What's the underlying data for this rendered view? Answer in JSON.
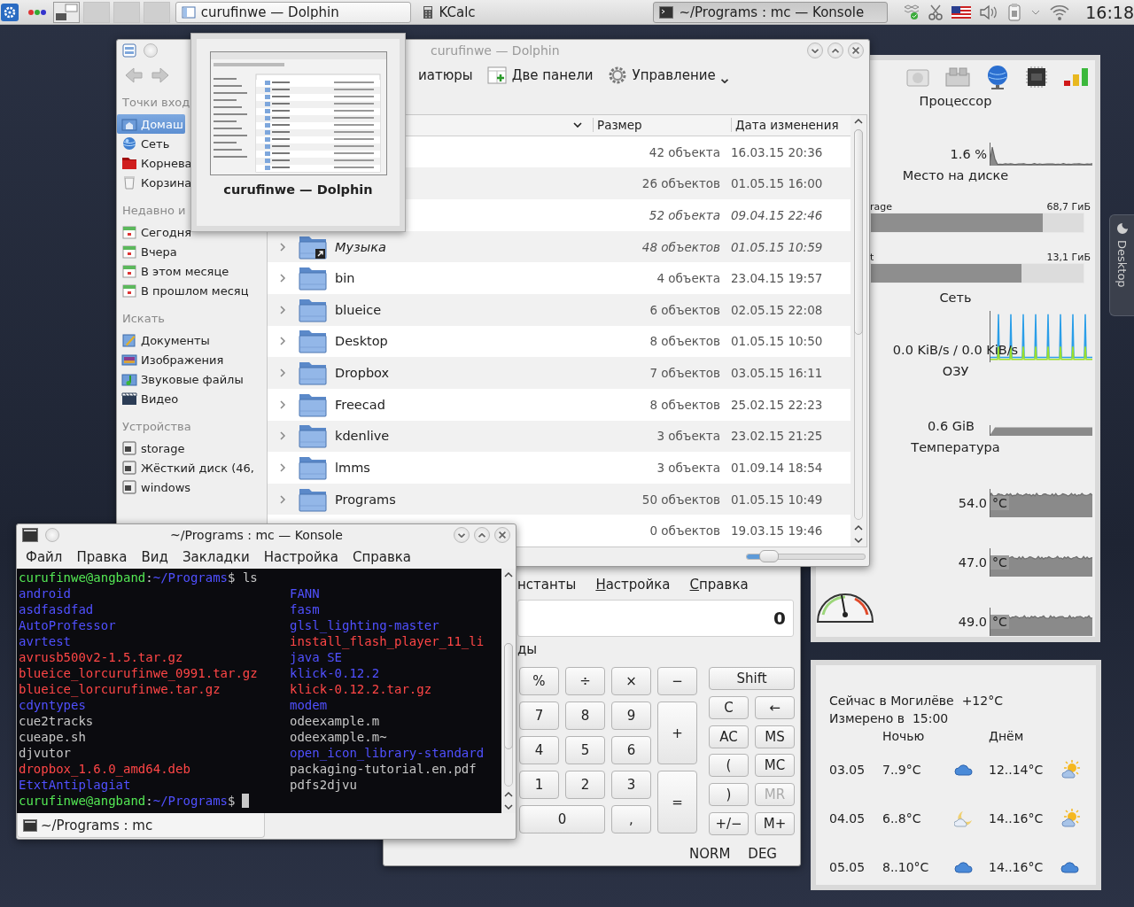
{
  "taskbar": {
    "pager": [
      {
        "selected": true
      },
      {
        "selected": false
      },
      {
        "selected": false
      },
      {
        "selected": false
      }
    ],
    "tasks": [
      {
        "title": "curufinwe — Dolphin",
        "kind": "framed",
        "selected": false
      },
      {
        "title": "KCalc",
        "kind": "plain",
        "selected": false
      },
      {
        "title": "~/Programs : mc — Konsole",
        "kind": "framed",
        "selected": true
      }
    ],
    "clock": "16:18"
  },
  "dolphin": {
    "title": "curufinwe — Dolphin",
    "toolbar": [
      {
        "label": "иатюры",
        "kind": "plain"
      },
      {
        "label": "Две панели",
        "kind": "split"
      },
      {
        "label": "Управление",
        "kind": "menu"
      }
    ],
    "places": [
      {
        "title": "Точки вход",
        "items": [
          {
            "label": "Домаш",
            "kind": "home",
            "selected": true
          },
          {
            "label": "Сеть",
            "kind": "network",
            "selected": false
          },
          {
            "label": "Корнева",
            "kind": "root",
            "selected": false
          },
          {
            "label": "Корзина",
            "kind": "trash",
            "selected": false
          }
        ]
      },
      {
        "title": "Недавно и",
        "items": [
          {
            "label": "Сегодня",
            "kind": "calendar",
            "selected": false
          },
          {
            "label": "Вчера",
            "kind": "calendar",
            "selected": false
          },
          {
            "label": "В этом месяце",
            "kind": "calendar",
            "selected": false
          },
          {
            "label": "В прошлом месяц",
            "kind": "calendar",
            "selected": false
          }
        ]
      },
      {
        "title": "Искать",
        "items": [
          {
            "label": "Документы",
            "kind": "docs",
            "selected": false
          },
          {
            "label": "Изображения",
            "kind": "images",
            "selected": false
          },
          {
            "label": "Звуковые файлы",
            "kind": "audio",
            "selected": false
          },
          {
            "label": "Видео",
            "kind": "video",
            "selected": false
          }
        ]
      },
      {
        "title": "Устройства",
        "items": [
          {
            "label": "storage",
            "kind": "drive",
            "selected": false
          },
          {
            "label": "Жёсткий диск (46,",
            "kind": "drive",
            "selected": false
          },
          {
            "label": "windows",
            "kind": "drive",
            "selected": false
          }
        ]
      }
    ],
    "columns": [
      "Размер",
      "Дата изменения"
    ],
    "rows": [
      {
        "size": "42 объекта",
        "date": "16.03.15 20:36",
        "symlink": false
      },
      {
        "size": "26 объектов",
        "date": "01.05.15 16:00",
        "symlink": false
      },
      {
        "size": "52 объекта",
        "date": "09.04.15 22:46",
        "symlink": true
      },
      {
        "name": "Музыка",
        "size": "48 объектов",
        "date": "01.05.15 10:59",
        "symlink": true
      },
      {
        "name": "bin",
        "size": "4 объекта",
        "date": "23.04.15 19:57",
        "symlink": false
      },
      {
        "name": "blueice",
        "size": "6 объектов",
        "date": "02.05.15 22:08",
        "symlink": false
      },
      {
        "name": "Desktop",
        "size": "8 объектов",
        "date": "01.05.15 10:50",
        "symlink": false
      },
      {
        "name": "Dropbox",
        "size": "7 объектов",
        "date": "03.05.15 16:11",
        "symlink": false
      },
      {
        "name": "Freecad",
        "size": "8 объектов",
        "date": "25.02.15 22:23",
        "symlink": false
      },
      {
        "name": "kdenlive",
        "size": "3 объекта",
        "date": "23.02.15 21:25",
        "symlink": false
      },
      {
        "name": "lmms",
        "size": "3 объекта",
        "date": "01.09.14 18:54",
        "symlink": false
      },
      {
        "name": "Programs",
        "size": "50 объектов",
        "date": "01.05.15 10:49",
        "symlink": false
      },
      {
        "size": "0 объектов",
        "date": "19.03.15 19:46",
        "symlink": false
      }
    ],
    "zoom": {
      "level": 0.15
    }
  },
  "preview": {
    "caption": "curufinwe — Dolphin"
  },
  "kcalc": {
    "menu": [
      {
        "label": "нстанты",
        "mnemonic": false
      },
      {
        "label": "Настройка",
        "mnemonic": true
      },
      {
        "label": "Справка",
        "mnemonic": true
      }
    ],
    "display": "0",
    "radio_label": "ды",
    "keypad": [
      {
        "label": "%",
        "wide": false,
        "tall": false
      },
      {
        "label": "÷",
        "wide": false,
        "tall": false
      },
      {
        "label": "×",
        "wide": false,
        "tall": false
      },
      {
        "label": "−",
        "wide": false,
        "tall": false
      },
      {
        "label": "7",
        "wide": false,
        "tall": false
      },
      {
        "label": "8",
        "wide": false,
        "tall": false
      },
      {
        "label": "9",
        "wide": false,
        "tall": false
      },
      {
        "label": "+",
        "wide": false,
        "tall": true
      },
      {
        "label": "4",
        "wide": false,
        "tall": false
      },
      {
        "label": "5",
        "wide": false,
        "tall": false
      },
      {
        "label": "6",
        "wide": false,
        "tall": false
      },
      {
        "label": "1",
        "wide": false,
        "tall": false
      },
      {
        "label": "2",
        "wide": false,
        "tall": false
      },
      {
        "label": "3",
        "wide": false,
        "tall": false
      },
      {
        "label": "=",
        "wide": false,
        "tall": true
      },
      {
        "label": "0",
        "wide": true,
        "tall": false
      },
      {
        "label": ",",
        "wide": false,
        "tall": false
      }
    ],
    "memory": [
      {
        "label": "Shift",
        "wide": true,
        "disabled": false
      },
      {
        "label": "C",
        "wide": false,
        "disabled": false
      },
      {
        "label": "←",
        "wide": false,
        "disabled": false
      },
      {
        "label": "AC",
        "wide": false,
        "disabled": false
      },
      {
        "label": "MS",
        "wide": false,
        "disabled": false
      },
      {
        "label": "(",
        "wide": false,
        "disabled": false
      },
      {
        "label": "MC",
        "wide": false,
        "disabled": false
      },
      {
        "label": ")",
        "wide": false,
        "disabled": false
      },
      {
        "label": "MR",
        "wide": false,
        "disabled": true
      },
      {
        "label": "+/−",
        "wide": false,
        "disabled": false
      },
      {
        "label": "M+",
        "wide": false,
        "disabled": false
      }
    ],
    "status": [
      "NORM",
      "DEG"
    ]
  },
  "konsole": {
    "title": "~/Programs : mc — Konsole",
    "menu": [
      "Файл",
      "Правка",
      "Вид",
      "Закладки",
      "Настройка",
      "Справка"
    ],
    "lines": [
      {
        "kind": "prompt",
        "cursor": false,
        "parts": [
          {
            "text": "curufinwe@angband",
            "kind": "user"
          },
          {
            "text": ":",
            "kind": "plain"
          },
          {
            "text": "~/Programs",
            "kind": "path"
          },
          {
            "text": "$ ls",
            "kind": "plain"
          }
        ]
      },
      {
        "kind": "listing",
        "entries": [
          {
            "text": "android",
            "kind": "dir"
          },
          {
            "text": "FANN",
            "kind": "dir"
          }
        ]
      },
      {
        "kind": "listing",
        "entries": [
          {
            "text": "asdfasdfad",
            "kind": "dir"
          },
          {
            "text": "fasm",
            "kind": "dir"
          }
        ]
      },
      {
        "kind": "listing",
        "entries": [
          {
            "text": "AutoProfessor",
            "kind": "dir"
          },
          {
            "text": "glsl_lighting-master",
            "kind": "dir"
          }
        ]
      },
      {
        "kind": "listing",
        "entries": [
          {
            "text": "avrtest",
            "kind": "dir"
          },
          {
            "text": "install_flash_player_11_li",
            "kind": "archive"
          }
        ]
      },
      {
        "kind": "listing",
        "entries": [
          {
            "text": "avrusb500v2-1.5.tar.gz",
            "kind": "archive"
          },
          {
            "text": "java SE",
            "kind": "dir"
          }
        ]
      },
      {
        "kind": "listing",
        "entries": [
          {
            "text": "blueice_lorcurufinwe_0991.tar.gz",
            "kind": "archive"
          },
          {
            "text": "klick-0.12.2",
            "kind": "dir"
          }
        ]
      },
      {
        "kind": "listing",
        "entries": [
          {
            "text": "blueice_lorcurufinwe.tar.gz",
            "kind": "archive"
          },
          {
            "text": "klick-0.12.2.tar.gz",
            "kind": "archive"
          }
        ]
      },
      {
        "kind": "listing",
        "entries": [
          {
            "text": "cdyntypes",
            "kind": "dir"
          },
          {
            "text": "modem",
            "kind": "dir"
          }
        ]
      },
      {
        "kind": "listing",
        "entries": [
          {
            "text": "cue2tracks",
            "kind": "file"
          },
          {
            "text": "odeexample.m",
            "kind": "file"
          }
        ]
      },
      {
        "kind": "listing",
        "entries": [
          {
            "text": "cueape.sh",
            "kind": "file"
          },
          {
            "text": "odeexample.m~",
            "kind": "file"
          }
        ]
      },
      {
        "kind": "listing",
        "entries": [
          {
            "text": "djvutor",
            "kind": "file"
          },
          {
            "text": "open_icon_library-standard",
            "kind": "dir"
          }
        ]
      },
      {
        "kind": "listing",
        "entries": [
          {
            "text": "dropbox_1.6.0_amd64.deb",
            "kind": "archive"
          },
          {
            "text": "packaging-tutorial.en.pdf",
            "kind": "file"
          }
        ]
      },
      {
        "kind": "listing",
        "entries": [
          {
            "text": "EtxtAntiplagiat",
            "kind": "dir"
          },
          {
            "text": "pdfs2djvu",
            "kind": "file"
          }
        ]
      },
      {
        "kind": "prompt",
        "cursor": true,
        "parts": [
          {
            "text": "curufinwe@angband",
            "kind": "user"
          },
          {
            "text": ":",
            "kind": "plain"
          },
          {
            "text": "~/Programs",
            "kind": "path"
          },
          {
            "text": "$",
            "kind": "plain"
          }
        ]
      }
    ],
    "tab": "~/Programs : mc"
  },
  "monitor": {
    "cpu": {
      "title": "Процессор",
      "reading": "1.6 %"
    },
    "disk": {
      "title": "Место на диске",
      "drives": [
        {
          "label": "rage",
          "size": "68,7 ГиБ",
          "level": 0.81
        },
        {
          "label": "t",
          "size": "13,1 ГиБ",
          "level": 0.71
        }
      ]
    },
    "network": {
      "title": "Сеть",
      "reading": "0.0 KiB/s / 0.0 KiB/s"
    },
    "ram": {
      "title": "ОЗУ",
      "reading": "0.6 GiB"
    },
    "temperature": {
      "title": "Температура",
      "sensors": [
        {
          "reading": "54.0",
          "unit": "°C"
        },
        {
          "reading": "47.0",
          "unit": "°C"
        },
        {
          "reading": "49.0",
          "unit": "°C"
        }
      ]
    }
  },
  "weather": {
    "location": "Сейчас в Могилёве",
    "current": "+12°C",
    "measured_label": "Измерено в",
    "measured_time": "15:00",
    "night_header": "Ночью",
    "day_header": "Днём",
    "days": [
      {
        "date": "03.05",
        "night": {
          "temp": "7..9°C",
          "kind": "cloud"
        },
        "day": {
          "temp": "12..14°C",
          "kind": "sun"
        }
      },
      {
        "date": "04.05",
        "night": {
          "temp": "6..8°C",
          "kind": "moon"
        },
        "day": {
          "temp": "14..16°C",
          "kind": "sun"
        }
      },
      {
        "date": "05.05",
        "night": {
          "temp": "8..10°C",
          "kind": "cloud"
        },
        "day": {
          "temp": "14..16°C",
          "kind": "cloud"
        }
      }
    ]
  },
  "desktop_tab": {
    "label": "Desktop"
  }
}
